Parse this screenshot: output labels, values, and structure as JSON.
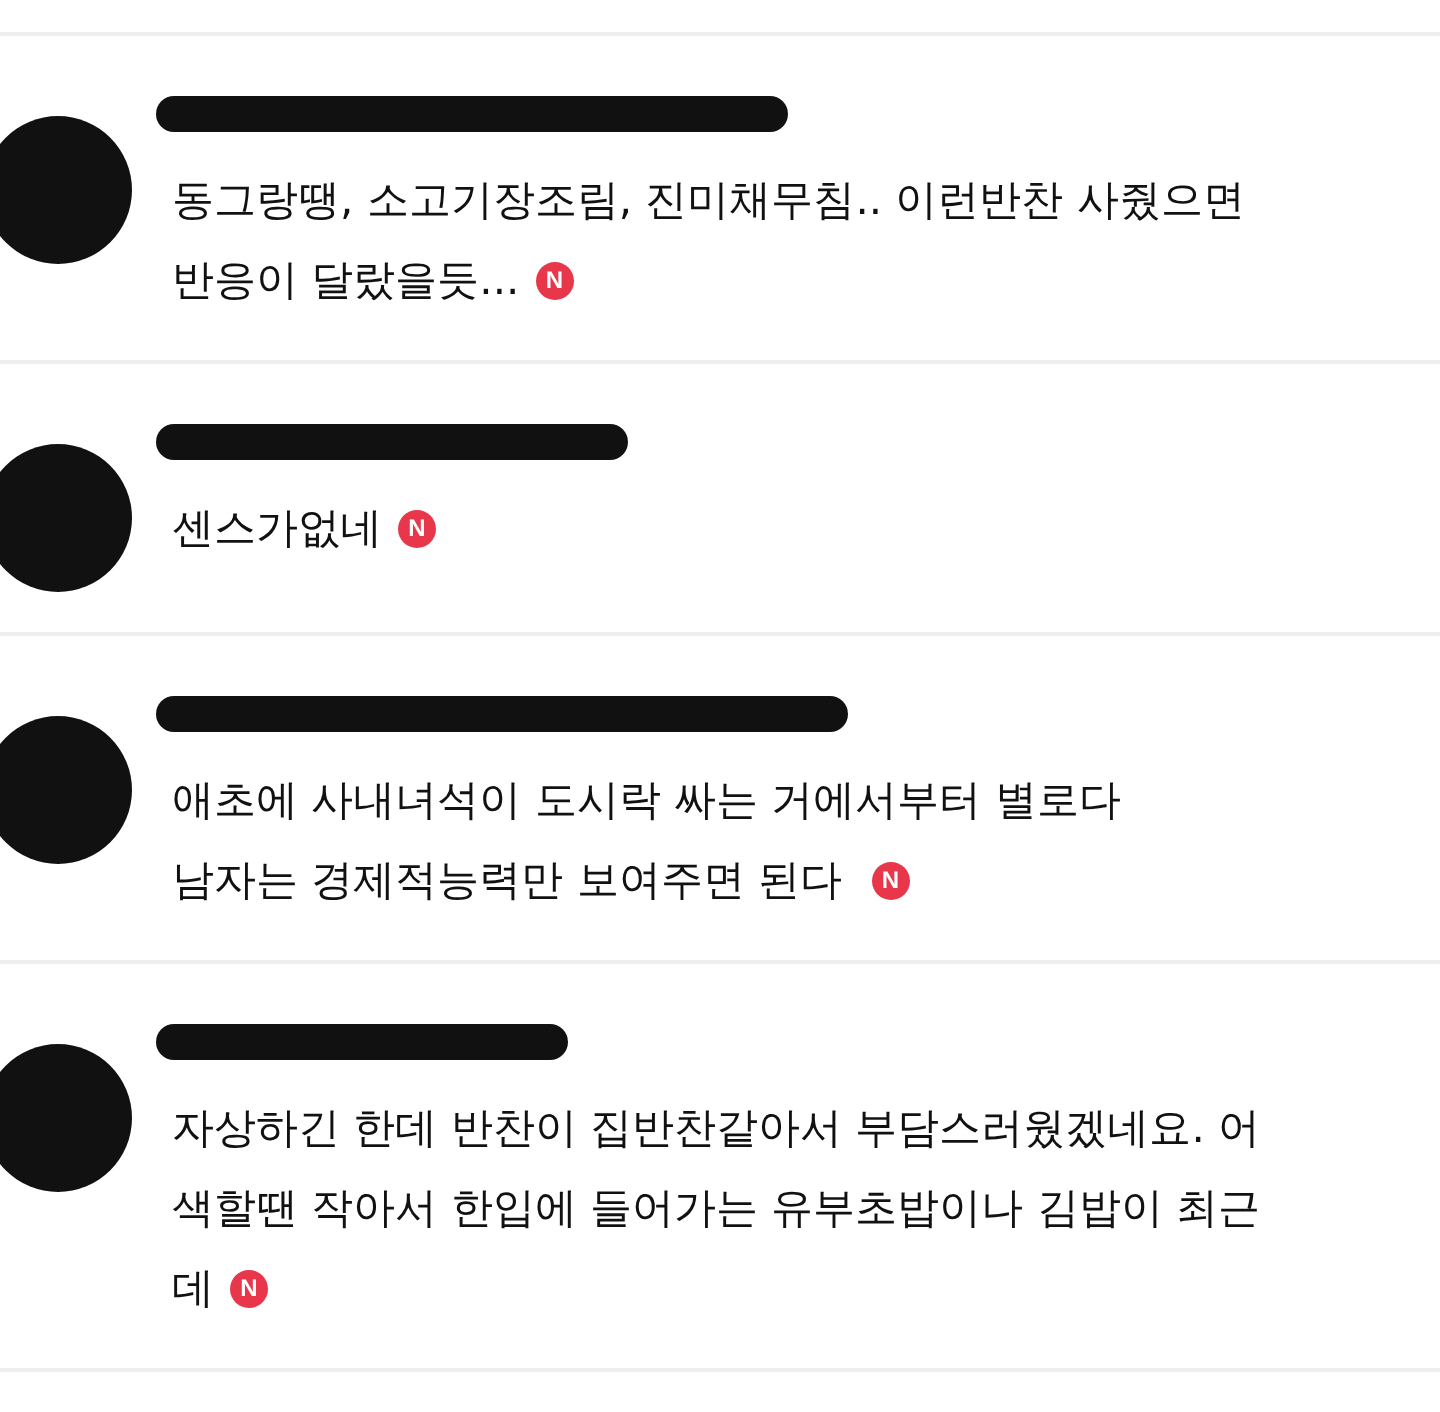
{
  "comments": [
    {
      "lines": [
        "동그랑땡, 소고기장조림, 진미채무침.. 이런반찬 사줬으면",
        "반응이 달랐을듯..."
      ],
      "badge": "N"
    },
    {
      "lines": [
        "센스가없네"
      ],
      "badge": "N"
    },
    {
      "lines": [
        "애초에 사내녀석이 도시락 싸는 거에서부터 별로다",
        "남자는 경제적능력만 보여주면 된다 "
      ],
      "badge": "N"
    },
    {
      "lines": [
        "자상하긴 한데 반찬이 집반찬같아서 부담스러웠겠네요. 어",
        "색할땐 작아서 한입에 들어가는 유부초밥이나 김밥이 최근",
        "데"
      ],
      "badge": "N"
    }
  ]
}
